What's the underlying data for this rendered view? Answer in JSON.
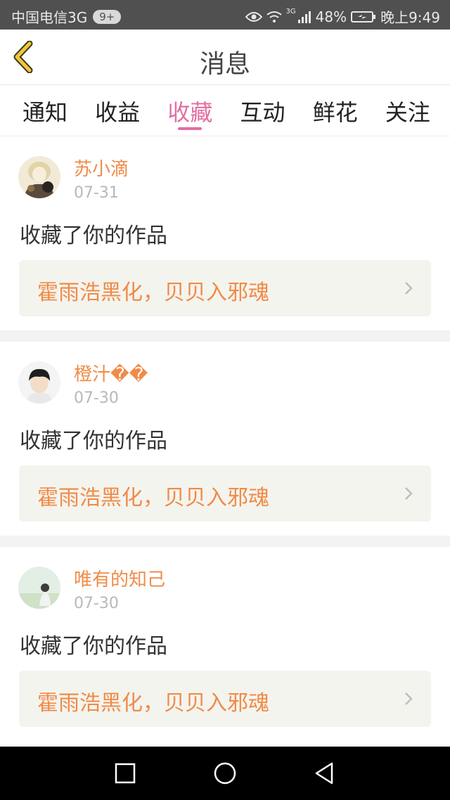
{
  "status_bar": {
    "carrier": "中国电信3G",
    "badge": "9+",
    "network": "3G",
    "battery": "48%",
    "time": "晚上9:49"
  },
  "header": {
    "title": "消息"
  },
  "tabs": [
    {
      "label": "通知",
      "active": false
    },
    {
      "label": "收益",
      "active": false
    },
    {
      "label": "收藏",
      "active": true
    },
    {
      "label": "互动",
      "active": false
    },
    {
      "label": "鲜花",
      "active": false
    },
    {
      "label": "关注",
      "active": false
    }
  ],
  "messages": [
    {
      "user": "苏小滴",
      "date": "07-31",
      "action": "收藏了你的作品",
      "work": "霍雨浩黑化，贝贝入邪魂"
    },
    {
      "user": "橙汁��",
      "date": "07-30",
      "action": "收藏了你的作品",
      "work": "霍雨浩黑化，贝贝入邪魂"
    },
    {
      "user": "唯有的知己",
      "date": "07-30",
      "action": "收藏了你的作品",
      "work": "霍雨浩黑化，贝贝入邪魂"
    }
  ],
  "icons": {
    "back": "chevron-left-icon",
    "work_arrow": "chevron-right-icon",
    "nav_recents": "square-icon",
    "nav_home": "circle-icon",
    "nav_back": "triangle-back-icon"
  },
  "colors": {
    "accent_pink": "#e36ea2",
    "name_orange": "#f08b48",
    "back_arrow": "#f2c53a"
  }
}
